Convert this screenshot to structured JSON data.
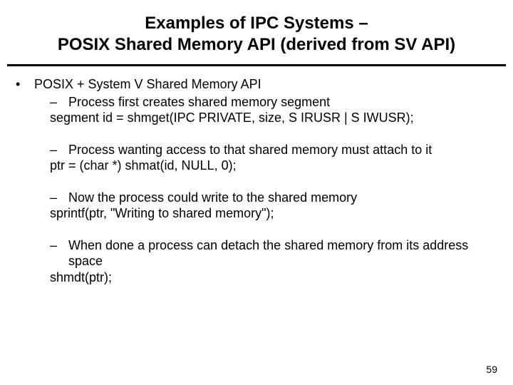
{
  "title_line1": "Examples of IPC Systems –",
  "title_line2": "POSIX Shared Memory API (derived from SV API)",
  "bullet1": "POSIX + System V Shared Memory API",
  "sub1": "Process first creates shared memory segment",
  "code1": "segment id = shmget(IPC PRIVATE, size, S IRUSR | S IWUSR);",
  "sub2": "Process wanting access to that shared memory must attach to it",
  "code2": "ptr = (char *) shmat(id, NULL, 0);",
  "sub3": "Now the process could write to the shared memory",
  "code3": "sprintf(ptr, \"Writing to shared memory\");",
  "sub4": "When done a process can detach the shared memory from its address space",
  "code4": "shmdt(ptr);",
  "page_number": "59"
}
